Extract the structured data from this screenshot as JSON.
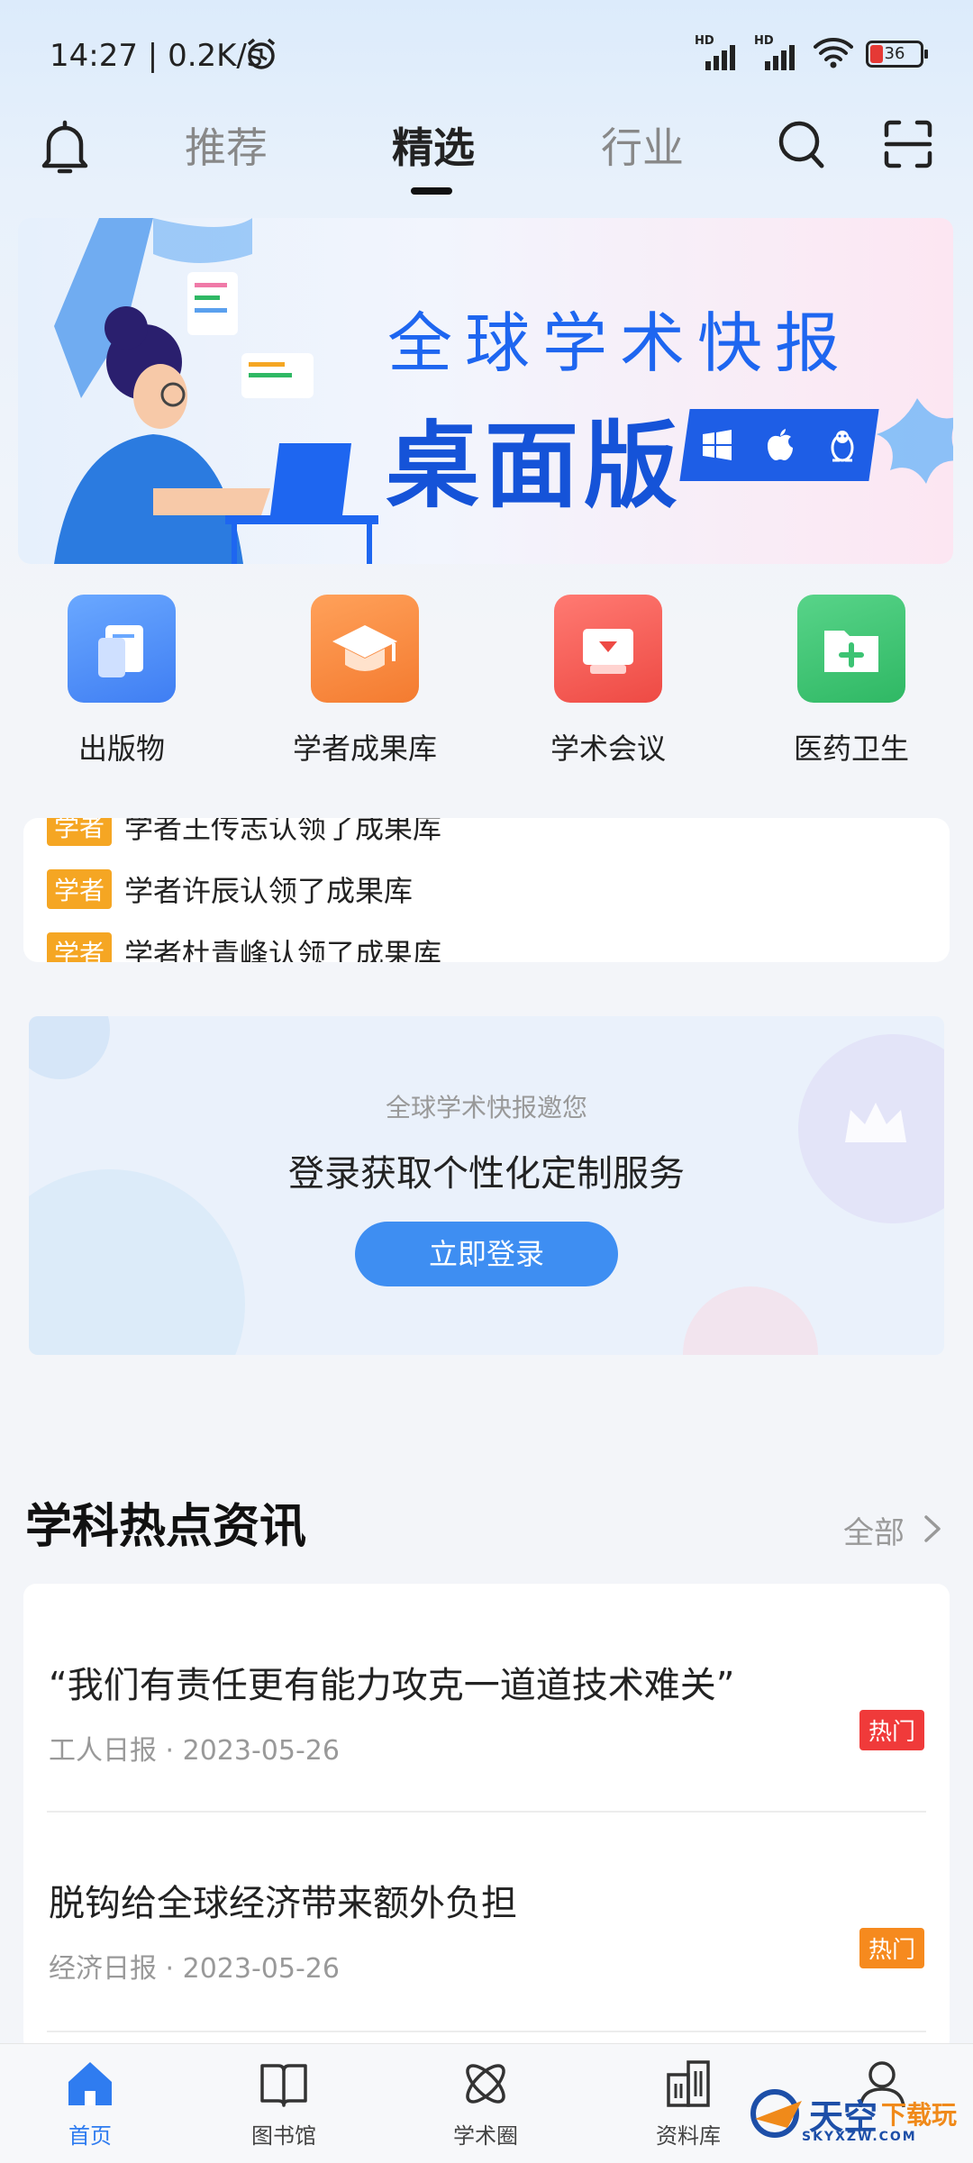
{
  "status_bar": {
    "time": "14:27",
    "speed": "0.2K/s",
    "network_badge_1": "HD",
    "network_badge_2": "HD",
    "battery": "36"
  },
  "header": {
    "tabs": [
      {
        "label": "推荐",
        "active": false
      },
      {
        "label": "精选",
        "active": true
      },
      {
        "label": "行业",
        "active": false
      }
    ]
  },
  "banner": {
    "title_line1": "全球学术快报",
    "title_line2": "桌面版"
  },
  "quick_links": [
    {
      "label": "出版物",
      "color": "#4f8ff7"
    },
    {
      "label": "学者成果库",
      "color": "#f68a3f"
    },
    {
      "label": "学术会议",
      "color": "#f2574f"
    },
    {
      "label": "医药卫生",
      "color": "#3cc373"
    }
  ],
  "ticker": {
    "tag": "学者",
    "items": [
      "学者王传志认领了成果库",
      "学者许辰认领了成果库",
      "学者杜青峰认领了成果库"
    ]
  },
  "login_card": {
    "subtitle": "全球学术快报邀您",
    "headline": "登录获取个性化定制服务",
    "button": "立即登录"
  },
  "news_section": {
    "title": "学科热点资讯",
    "all_label": "全部",
    "items": [
      {
        "title": "“我们有责任更有能力攻克一道道技术难关”",
        "meta": "工人日报 · 2023-05-26",
        "badge": "热门",
        "badge_color": "#f03a3a"
      },
      {
        "title": "脱钩给全球经济带来额外负担",
        "meta": "经济日报 · 2023-05-26",
        "badge": "热门",
        "badge_color": "#f68a1e"
      }
    ]
  },
  "bottom_nav": {
    "items": [
      {
        "label": "首页",
        "active": true
      },
      {
        "label": "图书馆",
        "active": false
      },
      {
        "label": "学术圈",
        "active": false
      },
      {
        "label": "资料库",
        "active": false
      },
      {
        "label": "我的",
        "active": false
      }
    ]
  },
  "watermark": {
    "brand": "天空",
    "suffix": "下载玩",
    "domain": "SKYXZW.COM"
  },
  "colors": {
    "accent": "#2f7cf0",
    "banner_blue": "#1553d8"
  }
}
